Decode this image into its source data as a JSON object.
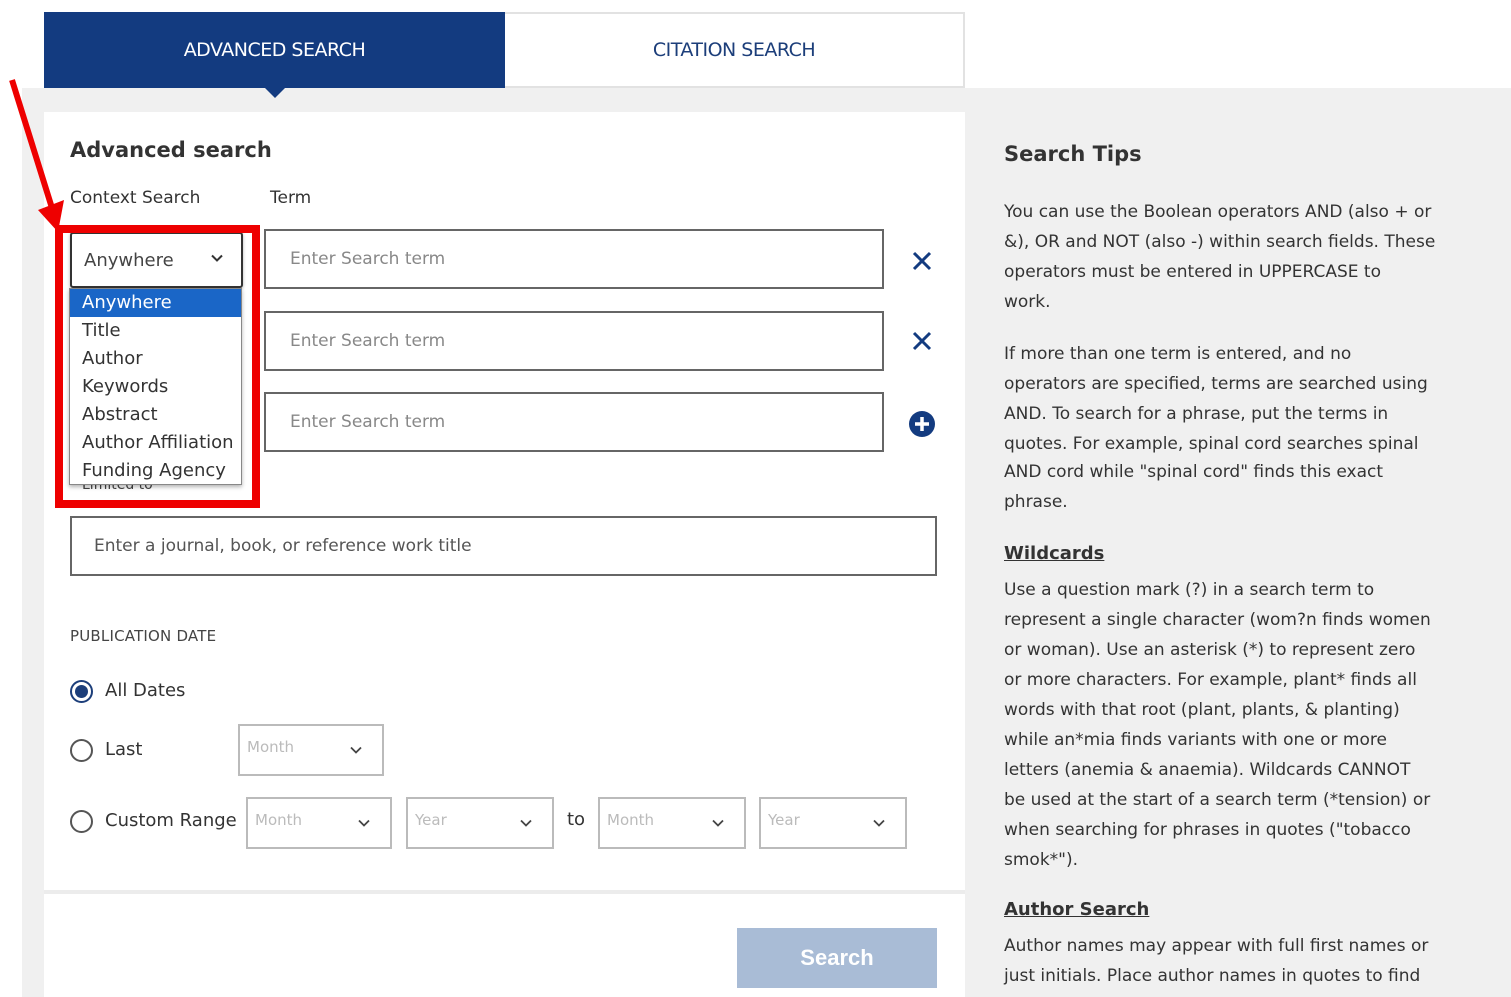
{
  "tabs": {
    "advanced": "ADVANCED SEARCH",
    "citation": "CITATION SEARCH"
  },
  "form": {
    "title": "Advanced search",
    "context_label": "Context Search",
    "term_label": "Term",
    "context_selected": "Anywhere",
    "context_options": [
      "Anywhere",
      "Title",
      "Author",
      "Keywords",
      "Abstract",
      "Author Affiliation",
      "Funding Agency"
    ],
    "partial_label": "Limited to",
    "term_placeholder": "Enter Search term",
    "journal_placeholder": "Enter a journal, book, or reference work title",
    "publication_date_title": "PUBLICATION DATE",
    "radio_all": "All Dates",
    "radio_last": "Last",
    "radio_custom": "Custom Range",
    "month_placeholder": "Month",
    "year_placeholder": "Year",
    "to_label": "to",
    "search_button": "Search"
  },
  "tips": {
    "title": "Search Tips",
    "para1": [
      "You can use the Boolean operators AND (also +  or",
      "&), OR and NOT (also -) within search fields. These",
      "operators must be entered in UPPERCASE to",
      "work."
    ],
    "para2": [
      "If more than one term is entered, and no",
      "operators are specified, terms are searched using",
      "AND.  To search for a phrase, put the terms in",
      "quotes.  For example, spinal cord searches spinal",
      "AND cord while \"spinal cord\" finds this exact",
      "phrase."
    ],
    "wildcards_heading": "Wildcards",
    "wildcards": [
      "Use a question mark (?) in a search term to",
      "represent a single character (wom?n finds women",
      "or woman).  Use an asterisk (*) to represent zero",
      "or more characters.   For example, plant* finds all",
      "words with that root (plant, plants, & planting)",
      "while an*mia finds variants with one or more",
      "letters (anemia & anaemia).  Wildcards CANNOT",
      "be used at the start of a search term (*tension) or",
      "when searching for phrases in quotes (\"tobacco",
      "smok*\")."
    ],
    "author_heading": "Author Search",
    "author": [
      "Author names may appear with full first names or",
      "just initials.  Place author names in quotes to find"
    ]
  },
  "colors": {
    "primary": "#133b80",
    "highlight": "#1a66c7",
    "annotation": "#ee0000",
    "button_disabled": "#a9bcd6"
  }
}
